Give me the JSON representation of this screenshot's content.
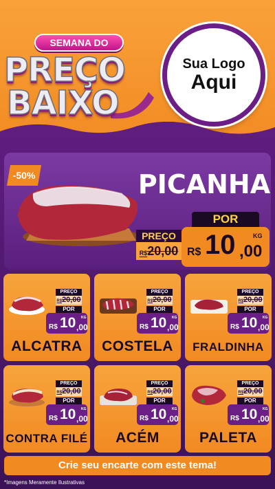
{
  "header": {
    "campaign_banner": "SEMANA DO",
    "campaign_line1": "PREÇO",
    "campaign_line2": "BAIXO",
    "logo_line1": "Sua Logo",
    "logo_line2": "Aqui"
  },
  "featured": {
    "discount": "-50%",
    "name": "PICANHA",
    "old_label": "PREÇO",
    "old_currency": "R$",
    "old_price": "20,00",
    "new_label": "POR",
    "new_currency": "R$",
    "new_int": "10",
    "new_dec": ",00",
    "unit": "KG"
  },
  "products": [
    {
      "name": "ALCATRA",
      "old_label": "PREÇO",
      "old_currency": "R$",
      "old_price": "20,00",
      "new_label": "POR",
      "currency": "R$",
      "int": "10",
      "dec": ",00",
      "unit": "KG"
    },
    {
      "name": "COSTELA",
      "old_label": "PREÇO",
      "old_currency": "R$",
      "old_price": "20,00",
      "new_label": "POR",
      "currency": "R$",
      "int": "10",
      "dec": ",00",
      "unit": "KG"
    },
    {
      "name": "FRALDINHA",
      "old_label": "PREÇO",
      "old_currency": "R$",
      "old_price": "20,00",
      "new_label": "POR",
      "currency": "R$",
      "int": "10",
      "dec": ",00",
      "unit": "KG"
    },
    {
      "name": "CONTRA FILÉ",
      "old_label": "PREÇO",
      "old_currency": "R$",
      "old_price": "20,00",
      "new_label": "POR",
      "currency": "R$",
      "int": "10",
      "dec": ",00",
      "unit": "KG"
    },
    {
      "name": "ACÉM",
      "old_label": "PREÇO",
      "old_currency": "R$",
      "old_price": "20,00",
      "new_label": "POR",
      "currency": "R$",
      "int": "10",
      "dec": ",00",
      "unit": "KG"
    },
    {
      "name": "PALETA",
      "old_label": "PREÇO",
      "old_currency": "R$",
      "old_price": "20,00",
      "new_label": "POR",
      "currency": "R$",
      "int": "10",
      "dec": ",00",
      "unit": "KG"
    }
  ],
  "cta": "Crie seu encarte com este tema!",
  "footer_note": "*Imagens Meramente Ilustrativas",
  "colors": {
    "orange": "#f28a22",
    "purple": "#6b1f86",
    "dark": "#1a0a24",
    "yellow": "#ffd23f"
  },
  "icons": {
    "meat_images": "raw-meat-cut-illustration"
  }
}
